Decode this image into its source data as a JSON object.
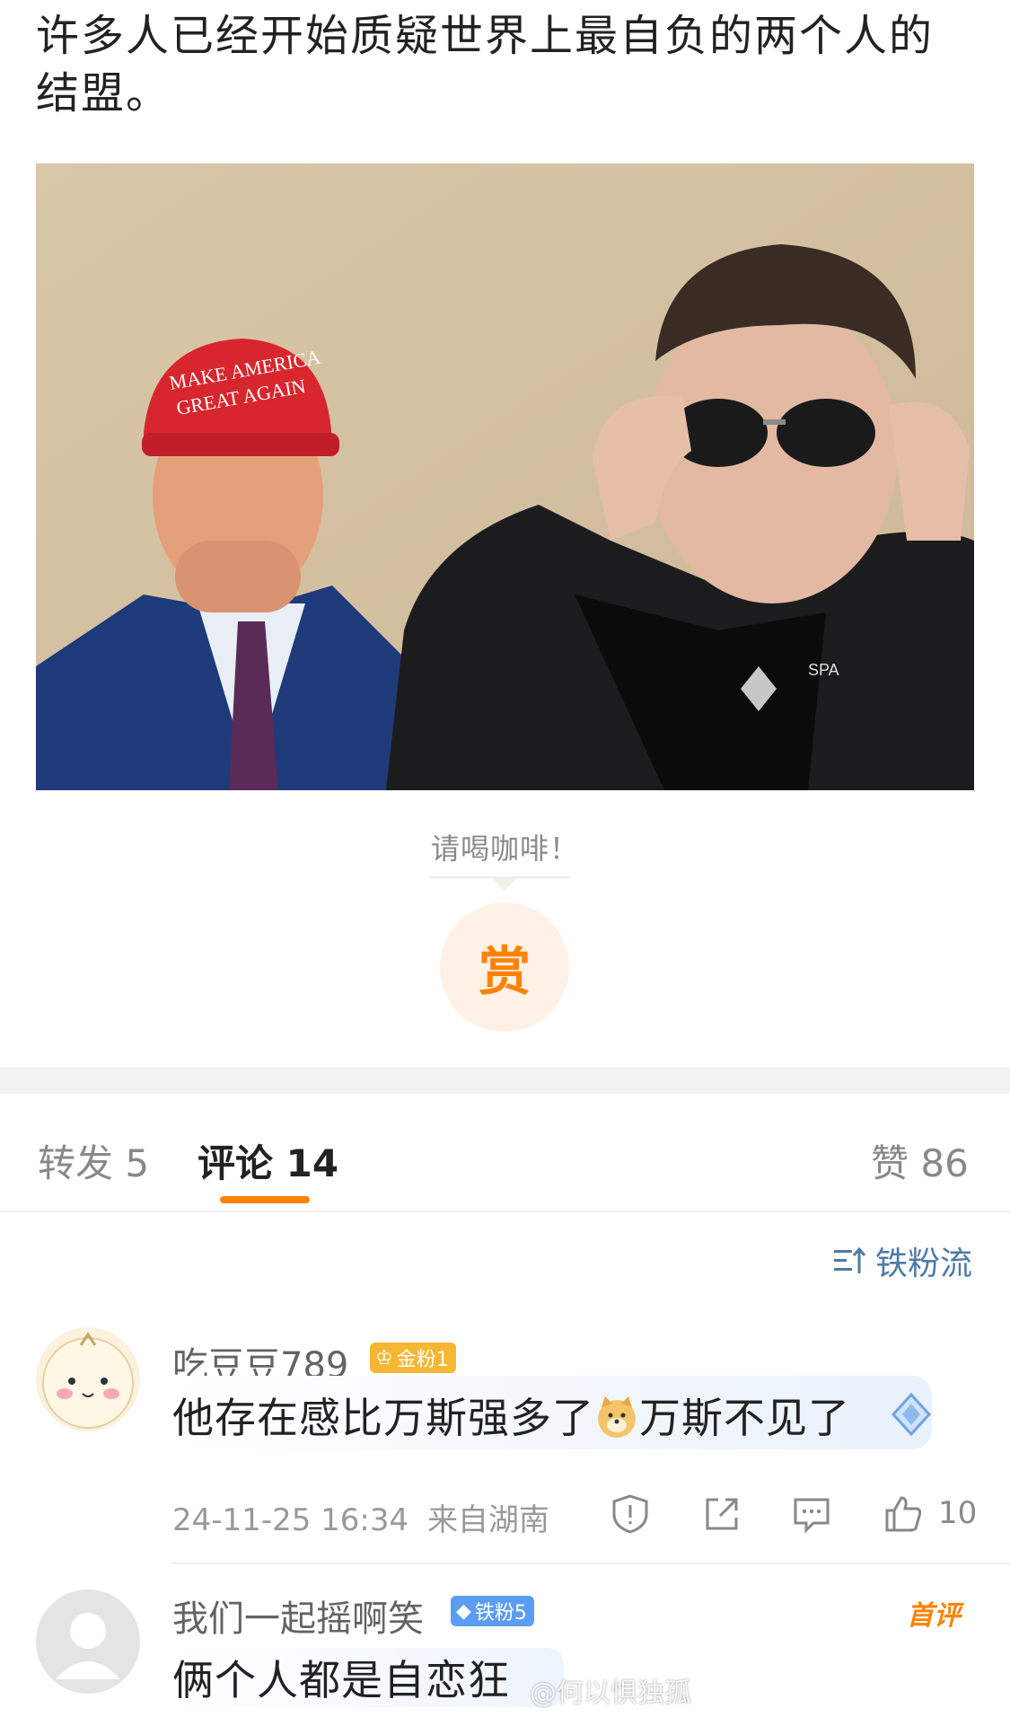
{
  "post": {
    "text": "许多人已经开始质疑世界上最自负的两个人的结盟。"
  },
  "photo": {
    "hat_text_line1": "MAKE AMERICA",
    "hat_text_line2": "GREAT AGAIN",
    "shirt_text": "SPA"
  },
  "tip": {
    "caption": "请喝咖啡！",
    "button_label": "赏"
  },
  "tabs": {
    "repost": {
      "label": "转发",
      "count": "5"
    },
    "comment": {
      "label": "评论",
      "count": "14"
    },
    "like": {
      "label": "赞",
      "count": "86"
    }
  },
  "sort": {
    "label": "铁粉流"
  },
  "comments": [
    {
      "username": "吃豆豆789",
      "badge": "金粉1",
      "text_before_emoji": "他存在感比万斯强多了",
      "emoji": "doge-face-icon",
      "text_after_emoji": "万斯不见了",
      "timestamp": "24-11-25 16:34",
      "location": "来自湖南",
      "likes": "10"
    },
    {
      "username": "我们一起摇啊笑",
      "badge": "铁粉5",
      "tag": "首评",
      "text": "俩个人都是自恋狂"
    }
  ],
  "watermark": "@何以惧独孤",
  "colors": {
    "accent": "#ff8200",
    "link": "#4d7aa8",
    "gold_badge": "#f5b731",
    "iron_badge": "#5c9cf3"
  }
}
